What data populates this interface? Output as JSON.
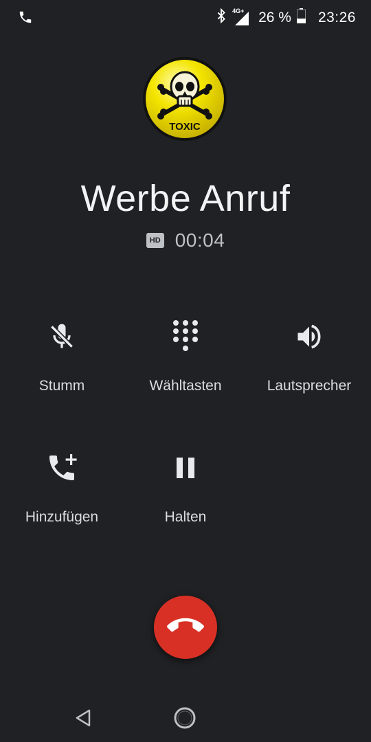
{
  "status_bar": {
    "network": "4G+",
    "battery_percent": "26 %",
    "time": "23:26",
    "icons": [
      "phone-icon",
      "bluetooth-icon",
      "signal-icon",
      "battery-icon"
    ]
  },
  "call": {
    "avatar_text": "TOXIC",
    "caller_name": "Werbe Anruf",
    "hd_badge": "HD",
    "duration": "00:04"
  },
  "controls": [
    {
      "label": "Stumm",
      "icon": "mic-off-icon"
    },
    {
      "label": "Wähltasten",
      "icon": "dialpad-icon"
    },
    {
      "label": "Lautsprecher",
      "icon": "speaker-icon"
    },
    {
      "label": "Hinzufügen",
      "icon": "add-call-icon"
    },
    {
      "label": "Halten",
      "icon": "pause-icon"
    }
  ],
  "end_call": {
    "icon": "call-end-icon",
    "color": "#d93025"
  },
  "nav": {
    "icons": [
      "back-icon",
      "home-icon"
    ]
  },
  "colors": {
    "background": "#202124",
    "text": "#e8eaed",
    "end_call_red": "#d93025",
    "avatar_yellow": "#f4e500"
  }
}
